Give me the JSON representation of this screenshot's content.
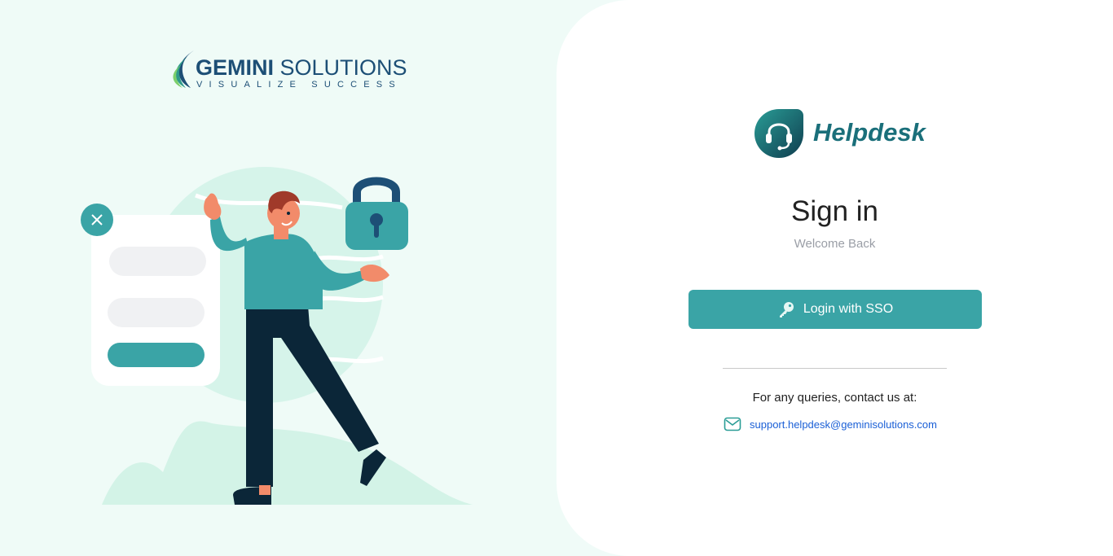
{
  "brand": {
    "name_part1": "GEMINI",
    "name_part2": " SOLUTIONS",
    "tagline": "VISUALIZE SUCCESS"
  },
  "app": {
    "name": "Helpdesk"
  },
  "signin": {
    "title": "Sign in",
    "subtitle": "Welcome Back",
    "sso_label": "Login with SSO"
  },
  "contact": {
    "prompt": "For any queries, contact us at:",
    "email": "support.helpdesk@geminisolutions.com"
  },
  "colors": {
    "accent": "#3aa4a6",
    "brand_navy": "#1d4f76",
    "link": "#1a5fd6"
  },
  "icons": [
    "leaf-logo-icon",
    "headset-icon",
    "key-icon",
    "mail-icon",
    "close-icon",
    "padlock-icon"
  ]
}
